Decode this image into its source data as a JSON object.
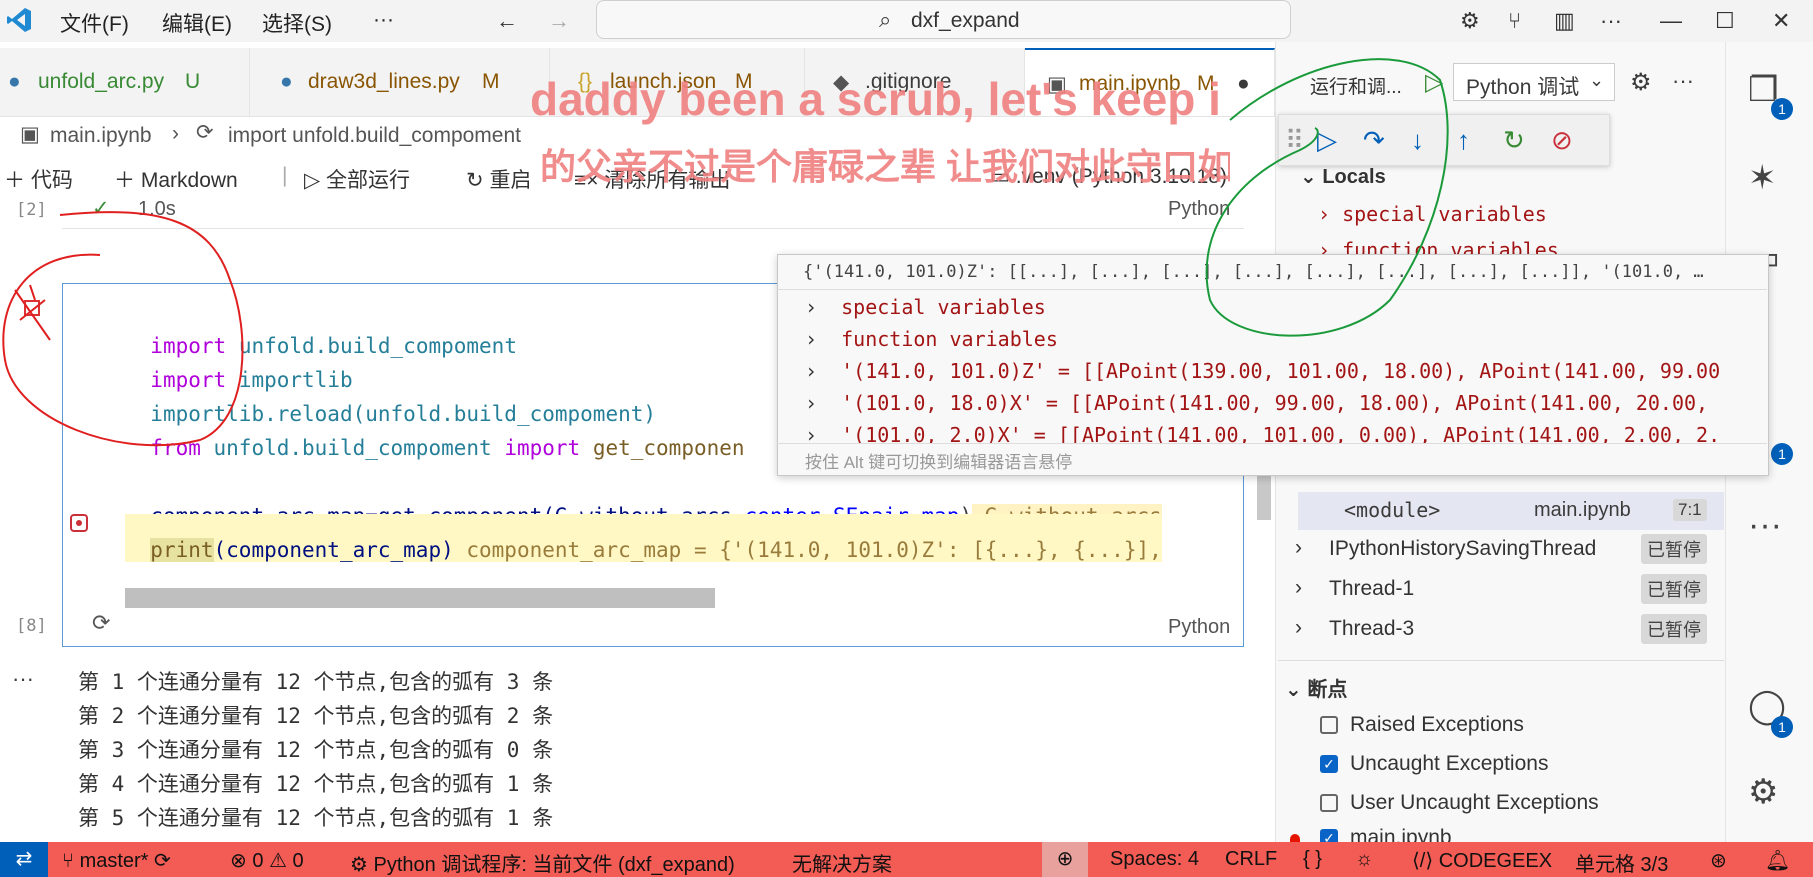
{
  "titlebar": {
    "menus": [
      "文件(F)",
      "编辑(E)",
      "选择(S)",
      "···"
    ],
    "search_text": "dxf_expand"
  },
  "tabs": [
    {
      "name": "unfold_arc.py",
      "status": "U",
      "color": "#388a34"
    },
    {
      "name": "draw3d_lines.py",
      "status": "M",
      "color": "#895503"
    },
    {
      "name": "launch.json",
      "status": "M"
    },
    {
      "name": ".gitignore",
      "status": ""
    },
    {
      "name": "main.ipynb",
      "status": "M"
    }
  ],
  "breadcrumb": {
    "file": "main.ipynb",
    "symbol": "import unfold.build_compoment"
  },
  "nbtoolbar": {
    "add_code": "代码",
    "add_markdown": "Markdown",
    "run_all": "全部运行",
    "restart": "重启",
    "clear_outputs": "清除所有输出",
    "kernel": ".venv (Python 3.10.18)"
  },
  "cell_prev": {
    "exec": "[2]",
    "time": "1.0s",
    "lang": "Python"
  },
  "cell": {
    "exec": "[8]",
    "lang": "Python",
    "lines": [
      {
        "t1": "import ",
        "t2": "unfold.build_compoment"
      },
      {
        "t1": "import ",
        "t2": "importlib"
      },
      {
        "t1": "importlib.reload(",
        "t2": "unfold.build_compoment)"
      },
      {
        "t1": "from ",
        "t2": "unfold.build_compoment ",
        "t3": "import ",
        "t4": "get_componen"
      },
      {
        "t1": "component_arc_map=get_component(G_without_arcs,",
        "t2": "center_SEpair_map",
        "t3": ")",
        "t4": " G_without_arcs"
      },
      {
        "t1": "print",
        "t2": "(component_arc_map)",
        "t3": " component_arc_map = {'(141.0, 101.0)Z': [{...}, {...}],"
      }
    ]
  },
  "output_lines": [
    "第 1 个连通分量有 12 个节点,包含的弧有 3 条",
    "第 2 个连通分量有 12 个节点,包含的弧有 2 条",
    "第 3 个连通分量有 12 个节点,包含的弧有 0 条",
    "第 4 个连通分量有 12 个节点,包含的弧有 1 条",
    "第 5 个连通分量有 12 个节点,包含的弧有 1 条"
  ],
  "hover": {
    "header": "{'(141.0, 101.0)Z': [[...], [...], [...], [...], [...], [...], [...], [...]], '(101.0, …",
    "rows": [
      "special variables",
      "function variables",
      "'(141.0, 101.0)Z' = [[APoint(139.00, 101.00, 18.00), APoint(141.00, 99.00",
      "'(101.0, 18.0)X' = [[APoint(141.00, 99.00, 18.00), APoint(141.00, 20.00,",
      "'(101.0, 2.0)X' = [[APoint(141.00, 101.00, 0.00), APoint(141.00, 2.00, 2."
    ],
    "footer": "按住 Alt 键可切换到编辑器语言悬停"
  },
  "debug": {
    "run_title": "运行和调...",
    "config": "Python 调试",
    "locals_label": "Locals",
    "locals_items": [
      "special variables",
      "function variables"
    ],
    "module_row": {
      "name": "<module>",
      "file": "main.ipynb",
      "pos": "7:1"
    },
    "threads": [
      {
        "name": "IPythonHistorySavingThread",
        "state": "已暂停"
      },
      {
        "name": "Thread-1",
        "state": "已暂停"
      },
      {
        "name": "Thread-3",
        "state": "已暂停"
      }
    ],
    "breakpoints_label": "断点",
    "breakpoints": [
      {
        "label": "Raised Exceptions",
        "checked": false
      },
      {
        "label": "Uncaught Exceptions",
        "checked": true
      },
      {
        "label": "User Uncaught Exceptions",
        "checked": false
      }
    ],
    "bp_file": "main.ipynb"
  },
  "activity_badges": [
    "1",
    "1",
    "1"
  ],
  "statusbar": {
    "branch": "master*",
    "errors": "0",
    "warnings": "0",
    "debug": "Python 调试程序: 当前文件 (dxf_expand)",
    "solution": "无解决方案",
    "spaces": "Spaces: 4",
    "eol": "CRLF",
    "braces": "{ }",
    "codegeex": "CODEGEEX",
    "cell": "单元格 3/3"
  },
  "overlay": {
    "line1": "daddy been a scrub, let's keep it",
    "line2": "的父亲不过是个庸碌之辈 让我们对此守口如瓶"
  }
}
